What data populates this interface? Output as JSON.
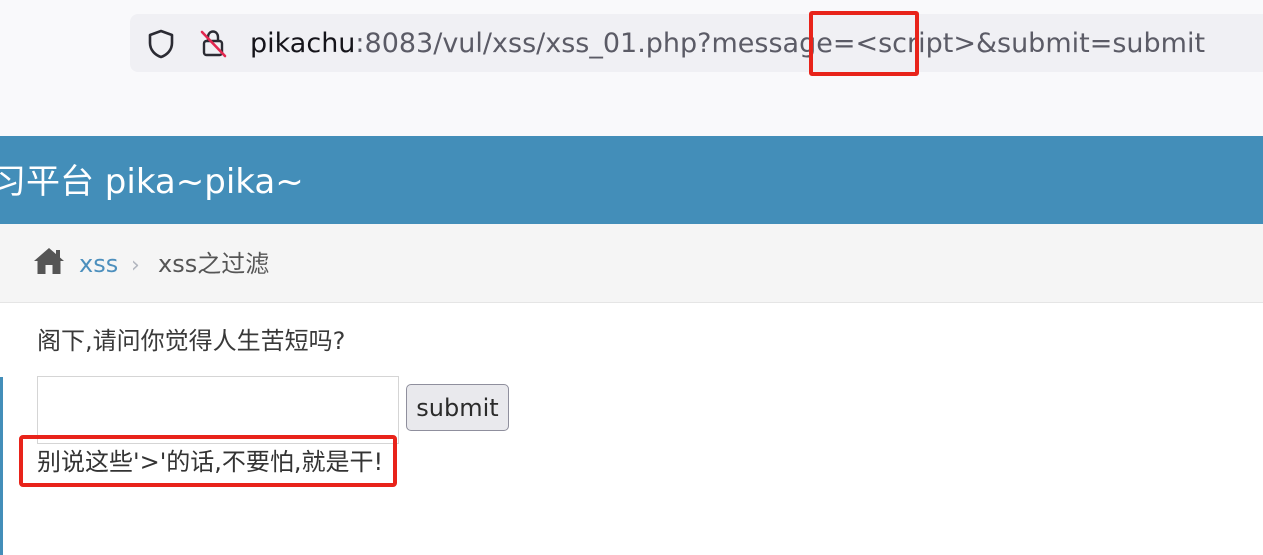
{
  "browser": {
    "url_host": "pikachu",
    "url_path": ":8083/vul/xss/xss_01.php?message=<script>&submit=submit",
    "icons": [
      "shield-icon",
      "insecure-lock-icon"
    ]
  },
  "header": {
    "title": "习平台 pika~pika~"
  },
  "breadcrumb": {
    "home_icon": "home-icon",
    "link": "xss",
    "separator": "›",
    "current": "xss之过滤"
  },
  "main": {
    "question": "阁下,请问你觉得人生苦短吗?",
    "input_value": "",
    "submit_label": "submit",
    "result": "别说这些'>'的话,不要怕,就是干!"
  },
  "annotations": {
    "highlight_color": "#e8231a"
  },
  "colors": {
    "banner": "#438eb9",
    "link": "#4c8fbd"
  }
}
